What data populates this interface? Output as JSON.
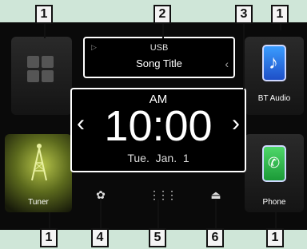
{
  "source": {
    "name": "USB",
    "song_title": "Song Title"
  },
  "clock": {
    "ampm": "AM",
    "time": "10:00",
    "date": "Tue.  Jan.  1"
  },
  "tiles": {
    "bt_audio_label": "BT Audio",
    "tuner_label": "Tuner",
    "phone_label": "Phone"
  },
  "callouts": [
    "1",
    "2",
    "3",
    "1",
    "1",
    "4",
    "5",
    "6",
    "1"
  ],
  "icons": {
    "top_left": "grid-icon",
    "bt": "music-note-icon",
    "tuner": "radio-tower-icon",
    "phone": "phone-icon",
    "setup": "gear-icon",
    "menu": "grid-menu-icon",
    "eject": "eject-icon"
  },
  "glyphs": {
    "prev": "‹",
    "next": "›",
    "setup": "✿",
    "menu": "⋮⋮⋮",
    "eject": "⏏",
    "source_flag": "▷",
    "source_chevron": "‹"
  }
}
